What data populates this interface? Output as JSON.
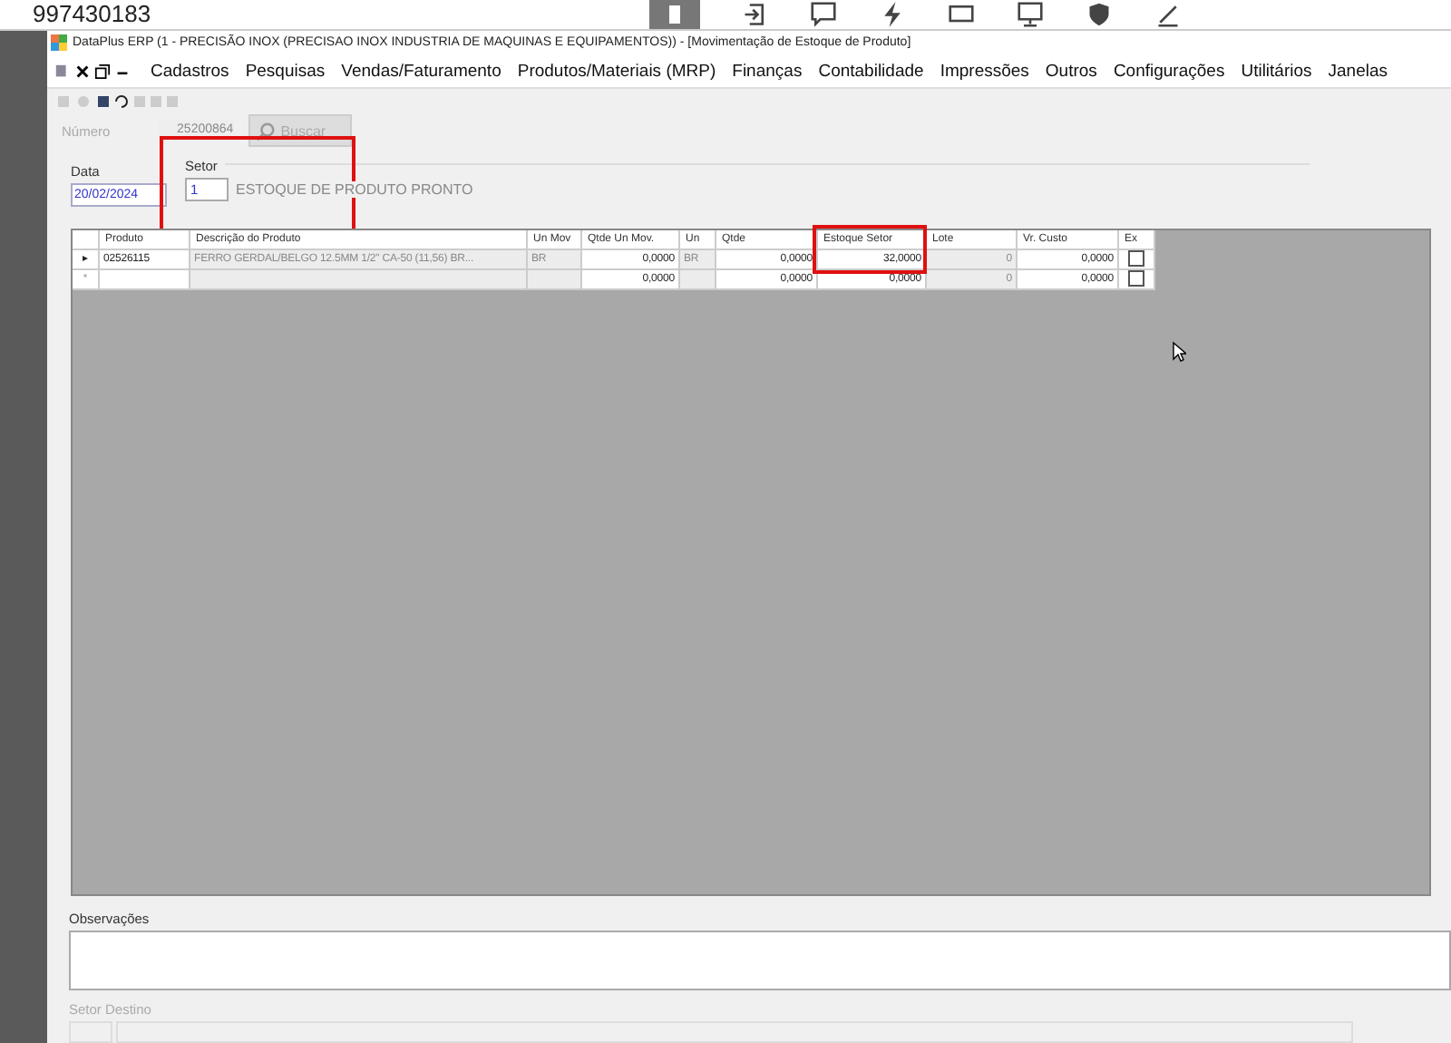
{
  "browser": {
    "address": "997430183"
  },
  "window": {
    "title": "DataPlus ERP (1 - PRECISÃO INOX  (PRECISAO INOX INDUSTRIA DE MAQUINAS E EQUIPAMENTOS)) - [Movimentação de Estoque de Produto]"
  },
  "menu": [
    "Cadastros",
    "Pesquisas",
    "Vendas/Faturamento",
    "Produtos/Materiais (MRP)",
    "Finanças",
    "Contabilidade",
    "Impressões",
    "Outros",
    "Configurações",
    "Utilitários",
    "Janelas"
  ],
  "numero": {
    "label": "Número",
    "value": "25200864",
    "button": "Buscar",
    "disabled": true
  },
  "data": {
    "label": "Data",
    "value": "20/02/2024"
  },
  "setor": {
    "label": "Setor",
    "code": "1",
    "name": "ESTOQUE DE PRODUTO PRONTO"
  },
  "table": {
    "columns": [
      "Produto",
      "Descrição do Produto",
      "Un Mov",
      "Qtde Un Mov.",
      "Un",
      "Qtde",
      "Estoque Setor",
      "Lote",
      "Vr. Custo",
      "Ex"
    ],
    "rows": [
      {
        "marker": "▸",
        "selected": true,
        "cells": [
          "02526115",
          "FERRO GERDAL/BELGO 12.5MM 1/2\" CA-50 (11,56) BR...",
          "BR",
          "0,0000",
          "BR",
          "0,0000",
          "32,0000",
          "0",
          "0,0000"
        ],
        "checked": false
      },
      {
        "marker": "*",
        "selected": false,
        "cells": [
          "",
          "",
          "",
          "0,0000",
          "",
          "0,0000",
          "0,0000",
          "0",
          "0,0000"
        ],
        "checked": false
      }
    ]
  },
  "observacoes": {
    "label": "Observações"
  },
  "setor_destino": {
    "label": "Setor Destino"
  }
}
